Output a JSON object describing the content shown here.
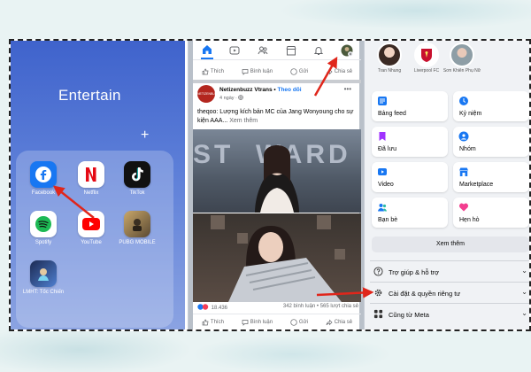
{
  "home_screen": {
    "folder_title": "Entertain",
    "add_symbol": "+",
    "apps": [
      {
        "label": "Facebook"
      },
      {
        "label": "Netflix"
      },
      {
        "label": "TikTok"
      },
      {
        "label": "Spotify"
      },
      {
        "label": "YouTube"
      },
      {
        "label": "PUBG MOBILE"
      },
      {
        "label": "LMHT: Tốc Chiến"
      }
    ]
  },
  "feed": {
    "top_actions": {
      "like": "Thích",
      "comment": "Bình luận",
      "send": "Gửi",
      "share": "Chia sẻ"
    },
    "post": {
      "author": "Netizenbuzz Vtrans",
      "follow": "Theo dõi",
      "avatar_text": "NETIZENBUZZ VTRANS",
      "time": "4 ngày",
      "text": "theqoo: Lượng kích bản MC của Jang Wonyoung cho sự kiện AAA...",
      "see_more": "Xem thêm",
      "backdrop_text": "ST  WARD",
      "reactions": "18.436",
      "comments": "342 bình luận",
      "shares": "565 lượt chia sẻ"
    },
    "bottom_actions": {
      "like": "Thích",
      "comment": "Bình luận",
      "send": "Gửi",
      "share": "Chia sẻ"
    }
  },
  "menu": {
    "shortcuts": [
      {
        "label": "Tran Nhung"
      },
      {
        "label": "Liverpool FC"
      },
      {
        "label": "Sơn Khiên Phụ Nữ"
      }
    ],
    "tiles": [
      {
        "label": "Bảng feed",
        "icon": "feed-icon"
      },
      {
        "label": "Kỷ niệm",
        "icon": "memories-icon"
      },
      {
        "label": "Đã lưu",
        "icon": "saved-icon"
      },
      {
        "label": "Nhóm",
        "icon": "groups-icon"
      },
      {
        "label": "Video",
        "icon": "video-icon"
      },
      {
        "label": "Marketplace",
        "icon": "marketplace-icon"
      },
      {
        "label": "Bạn bè",
        "icon": "friends-icon"
      },
      {
        "label": "Hẹn hò",
        "icon": "dating-icon"
      }
    ],
    "see_more": "Xem thêm",
    "rows": [
      {
        "label": "Trợ giúp & hỗ trợ",
        "icon": "help-icon"
      },
      {
        "label": "Cài đặt & quyền riêng tư",
        "icon": "settings-icon"
      },
      {
        "label": "Cũng từ Meta",
        "icon": "meta-icon"
      }
    ]
  },
  "colors": {
    "facebook_blue": "#1877f2",
    "arrow_red": "#e0261b",
    "home_bg": "#4a6fd3"
  }
}
